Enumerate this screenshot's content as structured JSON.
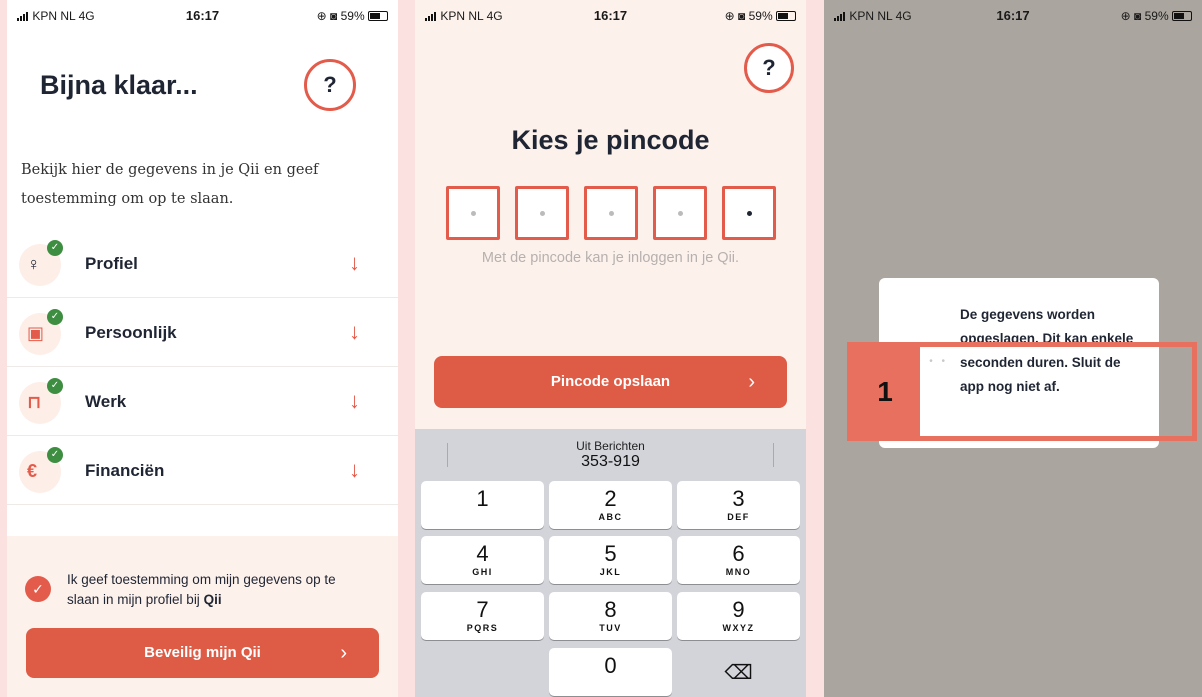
{
  "status_bars": [
    {
      "carrier": "KPN NL  4G",
      "time": "16:17",
      "battery": "59%"
    },
    {
      "carrier": "KPN NL  4G",
      "time": "16:17",
      "battery": "59%"
    },
    {
      "carrier": "KPN NL  4G",
      "time": "16:17",
      "battery": "59%"
    }
  ],
  "screen1": {
    "title": "Bijna klaar...",
    "help": "?",
    "intro": "Bekijk hier de gegevens in je Qii en geef toestemming om op te slaan.",
    "sections": [
      {
        "label": "Profiel",
        "icon": "person-icon"
      },
      {
        "label": "Persoonlijk",
        "icon": "id-card-icon"
      },
      {
        "label": "Werk",
        "icon": "briefcase-icon"
      },
      {
        "label": "Financiën",
        "icon": "euro-icon"
      }
    ],
    "consent_text": "Ik geef toestemming om mijn gegevens op te slaan in mijn profiel bij ",
    "consent_brand": "Qii",
    "button": "Beveilig mijn Qii"
  },
  "screen2": {
    "help": "?",
    "title": "Kies je pincode",
    "hint": "Met de pincode kan je inloggen in je Qii.",
    "button": "Pincode opslaan",
    "suggestion_label": "Uit Berichten",
    "suggestion_value": "353-919",
    "keys": [
      {
        "n": "1",
        "l": ""
      },
      {
        "n": "2",
        "l": "ABC"
      },
      {
        "n": "3",
        "l": "DEF"
      },
      {
        "n": "4",
        "l": "GHI"
      },
      {
        "n": "5",
        "l": "JKL"
      },
      {
        "n": "6",
        "l": "MNO"
      },
      {
        "n": "7",
        "l": "PQRS"
      },
      {
        "n": "8",
        "l": "TUV"
      },
      {
        "n": "9",
        "l": "WXYZ"
      },
      {
        "n": "0",
        "l": ""
      }
    ]
  },
  "screen3": {
    "message": "De gegevens worden opgeslagen. Dit kan enkele seconden duren. Sluit de app nog niet af.",
    "annotation_number": "1"
  },
  "colors": {
    "accent": "#de5b46",
    "check": "#3e8e41",
    "cream": "#fdf1ec",
    "overlay": "#aba59f"
  }
}
